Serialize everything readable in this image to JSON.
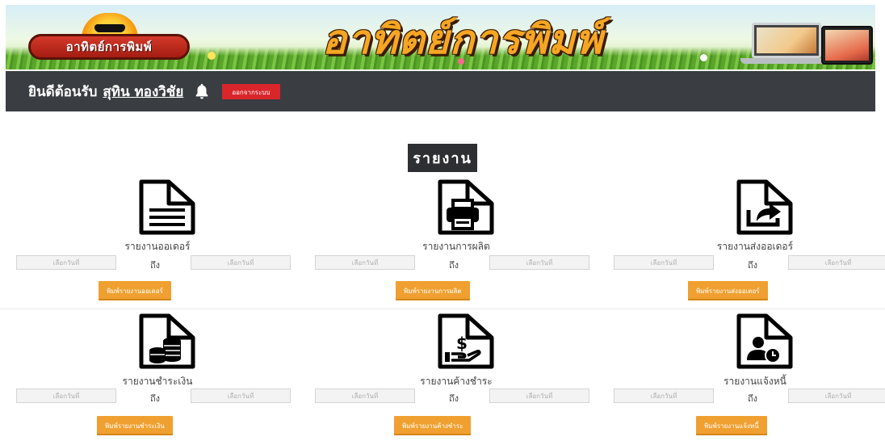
{
  "banner": {
    "logo_text": "อาทิตย์การพิมพ์",
    "title": "อาทิตย์การพิมพ์"
  },
  "topbar": {
    "welcome": "ยินดีต้อนรับ",
    "user_name": "สุทิน ทองวิชัย",
    "bell_icon": "bell-icon",
    "logout_label": "ออกจากระบบ"
  },
  "heading": "รายงาน",
  "date_separator": "ถึง",
  "date_placeholder": "เลือกวันที่",
  "reports": [
    {
      "icon": "document-icon",
      "label": "รายงานออเดอร์",
      "button": "พิมพ์รายงานออเดอร์"
    },
    {
      "icon": "printer-icon",
      "label": "รายงานการผลิต",
      "button": "พิมพ์รายงานการผลิต"
    },
    {
      "icon": "share-icon",
      "label": "รายงานส่งออเดอร์",
      "button": "พิมพ์รายงานส่งออเดอร์"
    },
    {
      "icon": "coins-icon",
      "label": "รายงานชำระเงิน",
      "button": "พิมพ์รายงานชำระเงิน"
    },
    {
      "icon": "dollar-hand-icon",
      "label": "รายงานค้างชำระ",
      "button": "พิมพ์รายงานค้างชำระ"
    },
    {
      "icon": "user-clock-icon",
      "label": "รายงานแจ้งหนี้",
      "button": "พิมพ์รายงานแจ้งหนี้"
    }
  ],
  "colors": {
    "topbar": "#3a3d42",
    "logout": "#d9262b",
    "print_button": "#f0a030",
    "heading_bg": "#2e2f32"
  }
}
